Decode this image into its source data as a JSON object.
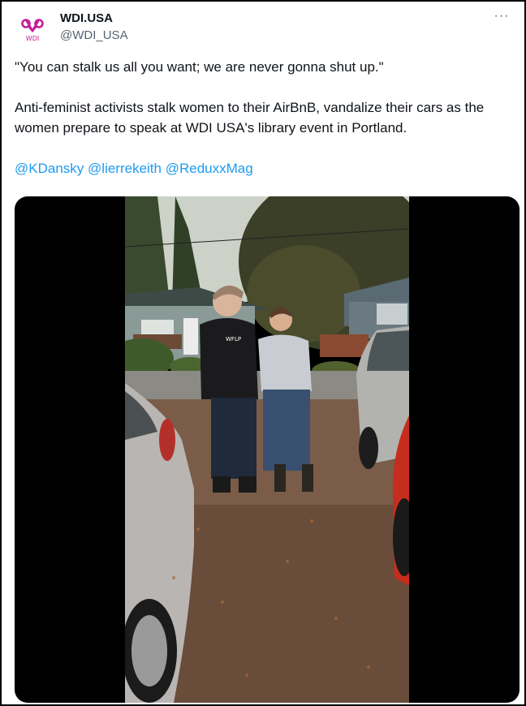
{
  "tweet": {
    "display_name": "WDI.USA",
    "handle": "@WDI_USA",
    "avatar_text": "WDI",
    "more_label": "···",
    "paragraph1": "\"You can stalk us all you want; we are never gonna shut up.\"",
    "paragraph2": "Anti-feminist activists stalk women to their AirBnB, vandalize their cars as the women prepare to speak at WDI USA's library event in Portland.",
    "mentions": [
      "@KDansky",
      "@lierrekeith",
      "@ReduxxMag"
    ]
  },
  "media": {
    "shirt_text": "WFLP"
  },
  "colors": {
    "brand": "#c21f9a",
    "link": "#1d9bf0",
    "text": "#0f1419",
    "muted": "#536471"
  }
}
